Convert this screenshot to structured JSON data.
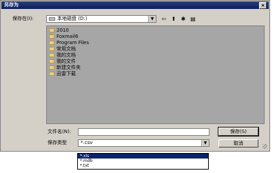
{
  "window": {
    "title": "另存为",
    "close_glyph": "×"
  },
  "save_in": {
    "label": "保存在(I):",
    "value": "本地磁盘 (D:)",
    "icon": "drive-icon"
  },
  "toolbar": {
    "back_icon": "⇦",
    "up_icon": "⬆",
    "new_folder_icon": "✱",
    "view_icon": "▤"
  },
  "files": [
    {
      "name": "2010",
      "icon": "folder-icon"
    },
    {
      "name": "Foxmail6",
      "icon": "folder-icon"
    },
    {
      "name": "Program Files",
      "icon": "folder-icon"
    },
    {
      "name": "常用文档",
      "icon": "folder-icon"
    },
    {
      "name": "我的文档",
      "icon": "folder-icon"
    },
    {
      "name": "我的文件",
      "icon": "folder-icon"
    },
    {
      "name": "新建文件夹",
      "icon": "folder-icon"
    },
    {
      "name": "迅雷下载",
      "icon": "folder-icon"
    }
  ],
  "filename": {
    "label": "文件名(N):",
    "value": ""
  },
  "filetype": {
    "label": "保存类型",
    "value": "*.csv"
  },
  "buttons": {
    "save": "保存(S)",
    "cancel": "取消"
  },
  "filetype_options": [
    "*.xls",
    "*.mdb",
    "*.txt"
  ],
  "colors": {
    "titlebar": "#0c1f5c",
    "dialog": "#d4d0c8",
    "list_bg": "#a6a6a6",
    "selection": "#0a246a"
  }
}
